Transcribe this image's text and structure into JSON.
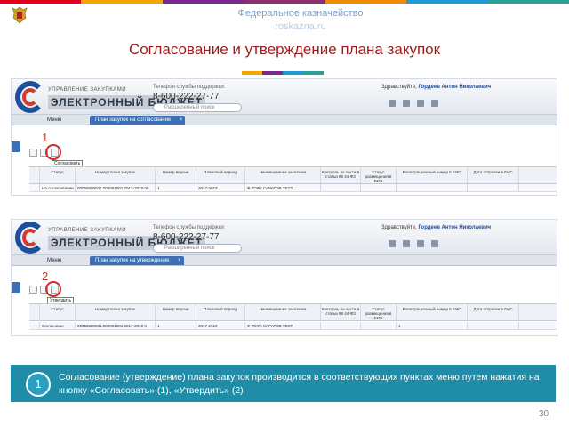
{
  "slide": {
    "org": "Федеральное казначейство",
    "site": "roskazna.ru",
    "title": "Согласование и утверждение плана закупок",
    "page_number": "30",
    "top_bar_colors": [
      "#e2001a",
      "#f5a400",
      "#7a2a8e",
      "#8d2f6f",
      "#f18a00",
      "#1d9bd7",
      "#2aa198"
    ],
    "accent_colors": [
      "#f5a400",
      "#7a2a8e",
      "#1d9bd7",
      "#2aa198"
    ]
  },
  "screen1": {
    "brand_small": "УПРАВЛЕНИЕ ЗАКУПКАМИ",
    "brand_big": "ЭЛЕКТРОННЫЙ БЮДЖЕТ",
    "support_label": "Телефон службы поддержки:",
    "support_phone": "8-600-222-27-77",
    "search_placeholder": "Расширенный поиск",
    "greeting_prefix": "Здравствуйте,",
    "greeting_name": "Гордеев Антон Николаевич",
    "menu": "Меню",
    "tab": "План закупок на согласование",
    "callout": "1",
    "tooltip": "Согласовать",
    "columns": [
      "",
      "Статус",
      "Номер плана закупок",
      "Номер версии",
      "Плановый период",
      "Наименование заказчика",
      "Контроль по части 5 статьи 99 44-ФЗ",
      "Статус размещения в ЕИС",
      "Регистрационный номер в ЕИС",
      "Дата отправки в ЕИС"
    ],
    "row": [
      "",
      "На согласовании",
      "00055500031.000001001 2017-2019 00",
      "1",
      "2017-2019",
      "Ф ТОФК САРАТОВ ТЕСТ",
      "",
      "",
      "",
      ""
    ]
  },
  "screen2": {
    "brand_small": "УПРАВЛЕНИЕ ЗАКУПКАМИ",
    "brand_big": "ЭЛЕКТРОННЫЙ БЮДЖЕТ",
    "support_label": "Телефон службы поддержки:",
    "support_phone": "8-600-222-27-77",
    "search_placeholder": "Расширенный поиск",
    "greeting_prefix": "Здравствуйте,",
    "greeting_name": "Гордеев Антон Николаевич",
    "menu": "Меню",
    "tab": "План закупок на утверждение",
    "callout": "2",
    "tooltip": "Утвердить",
    "columns": [
      "",
      "Статус",
      "Номер плана закупок",
      "Номер версии",
      "Плановый период",
      "Наименование заказчика",
      "Контроль по части 5 статьи 99 44-ФЗ",
      "Статус размещения в ЕИС",
      "Регистрационный номер в ЕИС",
      "Дата отправки в ЕИС"
    ],
    "row": [
      "",
      "Согласован",
      "00055500031.000001001 2017-2019 0",
      "1",
      "2017-2019",
      "Ф ТОФК САРАТОВ ТЕСТ",
      "",
      "",
      "1",
      ""
    ]
  },
  "info": {
    "number": "1",
    "text": "Согласование (утверждение) плана закупок производится в соответствующих пунктах меню путем нажатия на кнопку «Согласовать» (1), «Утвердить» (2)"
  }
}
